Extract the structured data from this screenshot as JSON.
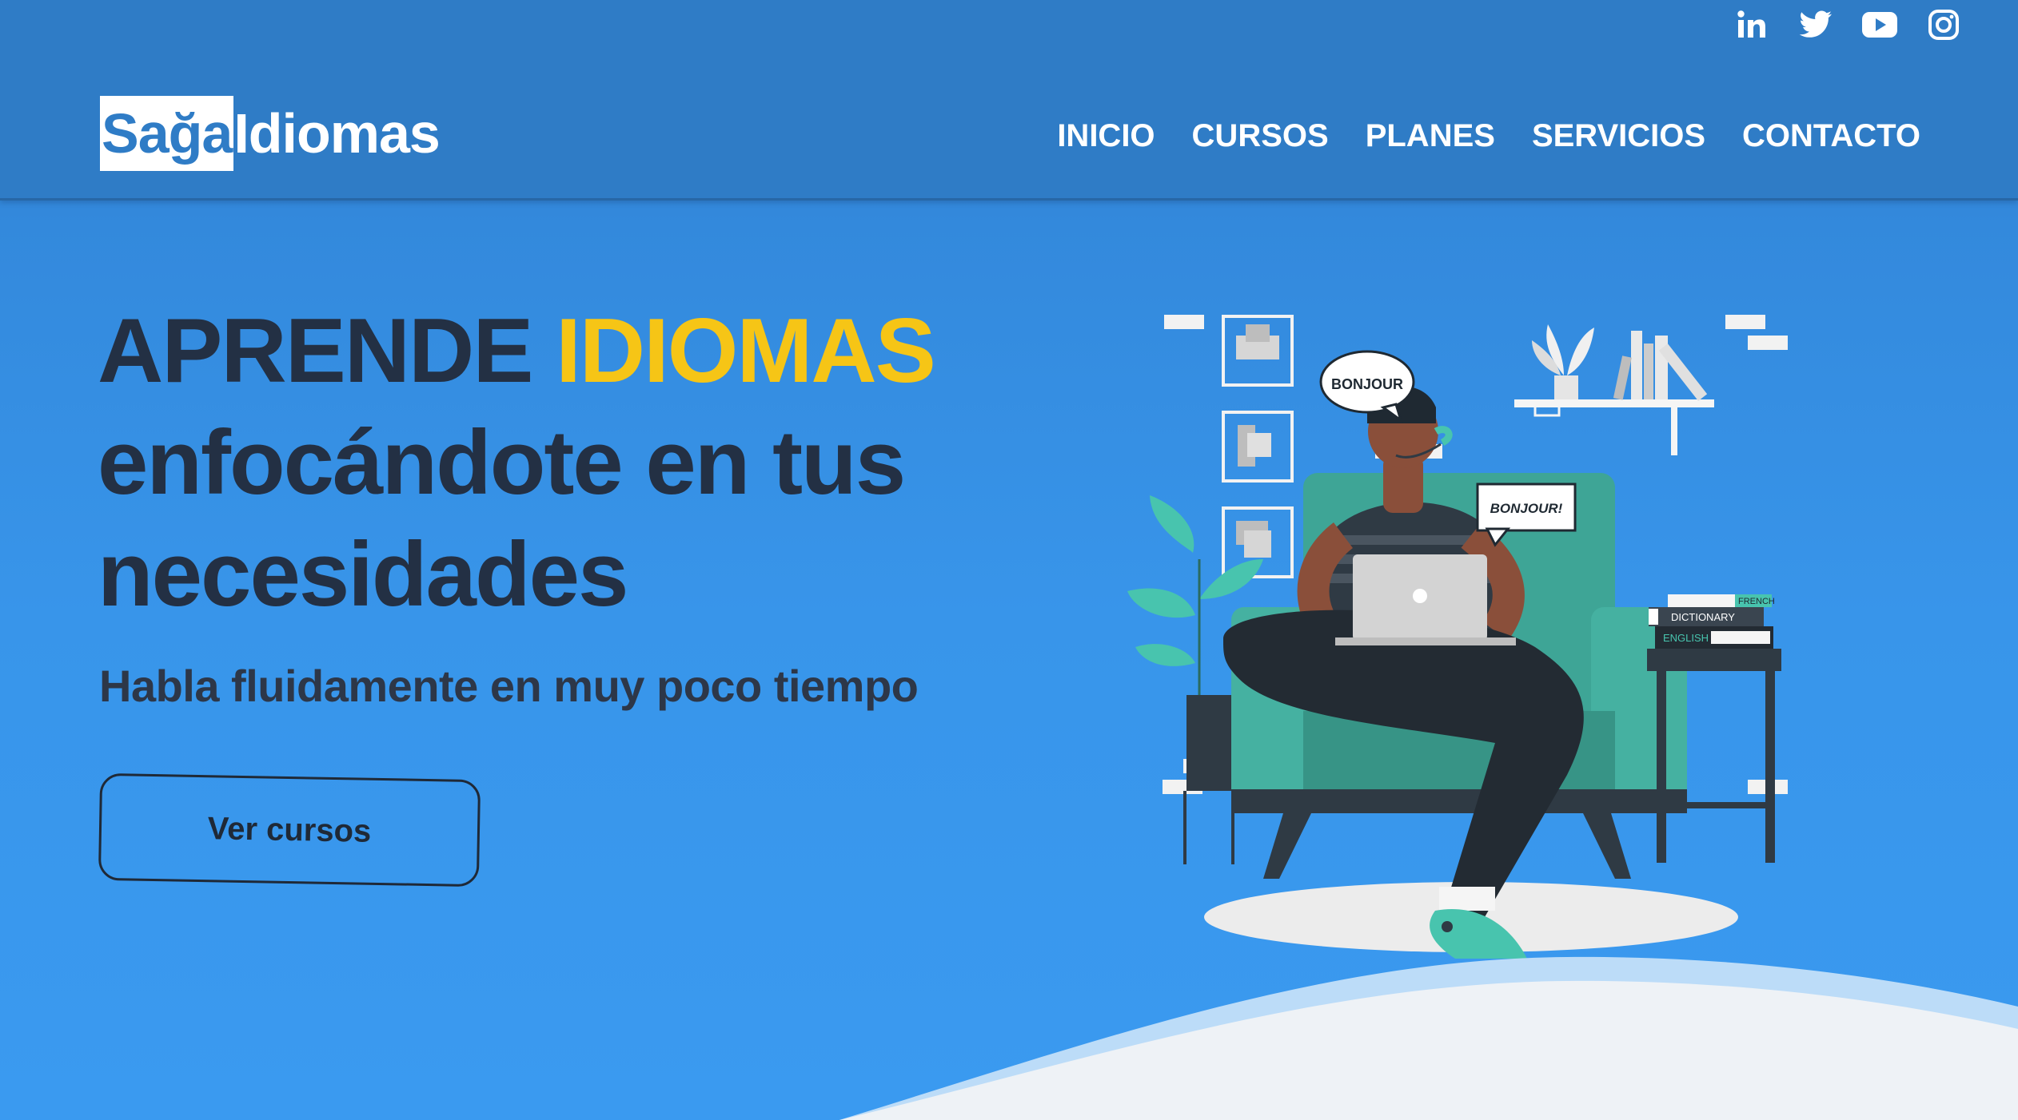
{
  "header": {
    "logo": {
      "highlighted": "Sağa",
      "rest": "Idiomas"
    },
    "nav": [
      {
        "label": "INICIO"
      },
      {
        "label": "CURSOS"
      },
      {
        "label": "PLANES"
      },
      {
        "label": "SERVICIOS"
      },
      {
        "label": "CONTACTO"
      }
    ],
    "social_icons": [
      "linkedin-icon",
      "twitter-icon",
      "youtube-icon",
      "instagram-icon"
    ]
  },
  "hero": {
    "title_part1": "APRENDE ",
    "title_accent": "IDIOMAS",
    "title_part2": "enfocándote en tus necesidades",
    "subtitle": "Habla fluidamente en muy poco tiempo",
    "cta_label": "Ver cursos"
  },
  "illustration": {
    "bubble_left": "BONJOUR",
    "bubble_right": "BONJOUR!",
    "book_top": "FRENCH",
    "book_middle": "DICTIONARY",
    "book_bottom": "ENGLISH"
  },
  "colors": {
    "header_bg": "#2f7cc6",
    "hero_bg": "#3a9af0",
    "title_text": "#233044",
    "accent": "#f6c516",
    "wave": "#eef2f6",
    "chair": "#3ea596"
  }
}
